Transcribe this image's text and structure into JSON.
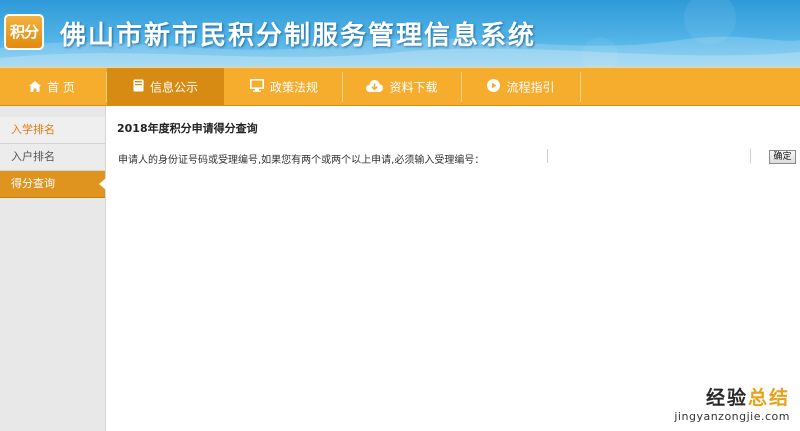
{
  "header": {
    "logo_text": "积分",
    "title": "佛山市新市民积分制服务管理信息系统"
  },
  "nav": {
    "items": [
      {
        "label": "首 页",
        "icon": "home-icon"
      },
      {
        "label": "信息公示",
        "icon": "book-icon"
      },
      {
        "label": "政策法规",
        "icon": "monitor-icon"
      },
      {
        "label": "资料下载",
        "icon": "cloud-download-icon"
      },
      {
        "label": "流程指引",
        "icon": "play-circle-icon"
      }
    ],
    "active_index": 1
  },
  "sidebar": {
    "items": [
      {
        "label": "入学排名"
      },
      {
        "label": "入户排名"
      },
      {
        "label": "得分查询"
      }
    ],
    "active_index": 2
  },
  "main": {
    "heading": "2018年度积分申请得分查询",
    "query_label": "申请人的身份证号码或受理编号,如果您有两个或两个以上申请,必须输入受理编号：",
    "input_value": "",
    "confirm_label": "确定"
  },
  "watermark": {
    "main_a": "经验",
    "main_b": "总结",
    "sub": "jingyanzongjie.com"
  },
  "colors": {
    "banner_blue": "#3fa7e0",
    "nav_orange": "#f6ac2c",
    "nav_active": "#d88b12",
    "sidebar_active": "#df9420"
  }
}
